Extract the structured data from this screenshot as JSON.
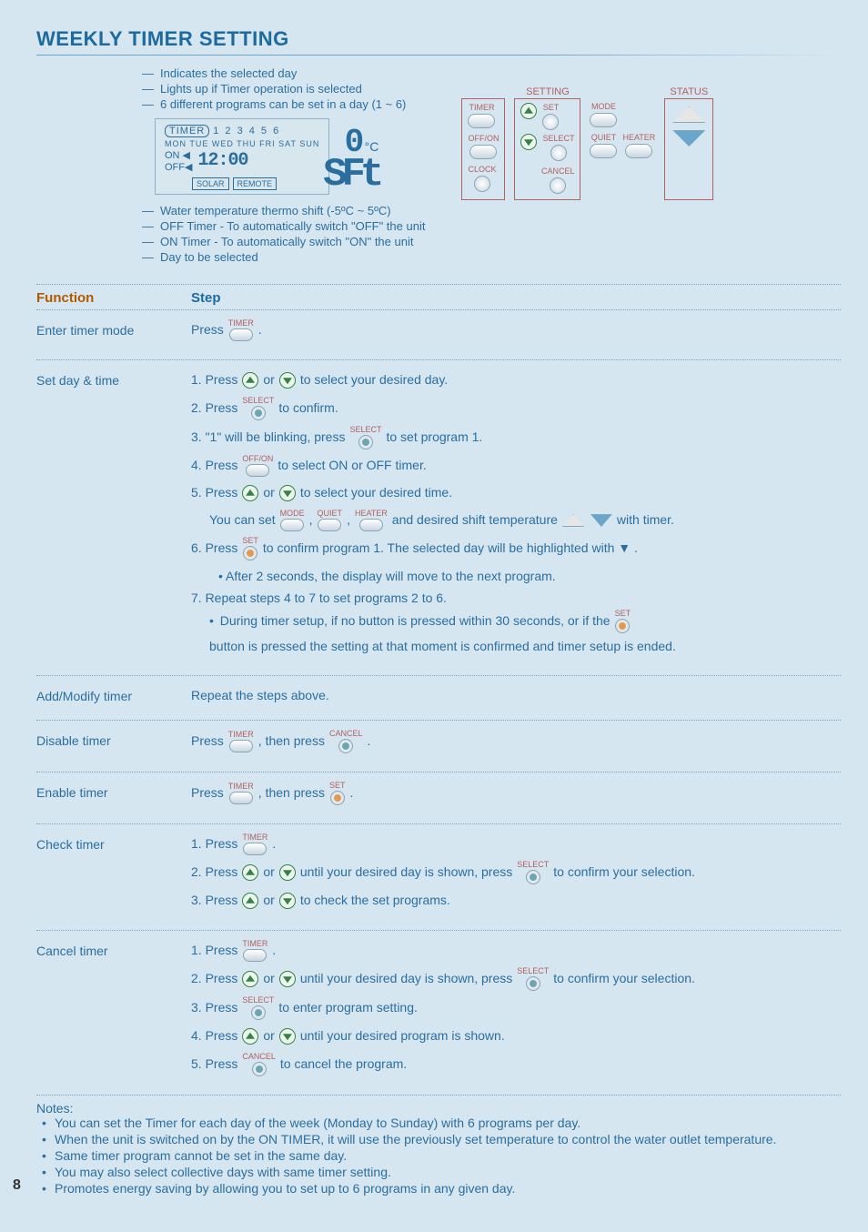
{
  "heading": "WEEKLY TIMER SETTING",
  "page_number": "8",
  "diagram": {
    "top_callouts": [
      "Indicates the selected day",
      "Lights up if Timer operation is selected",
      "6 different programs can be set in a day (1 ~ 6)"
    ],
    "lcd": {
      "timer_label": "TIMER",
      "programs": "1 2 3 4 5 6",
      "days": "MON TUE WED THU FRI SAT SUN",
      "on": "ON ◀",
      "off": "OFF◀",
      "time": "12:00",
      "solar": "SOLAR",
      "remote": "REMOTE",
      "temp_num": "0",
      "temp_c": "°C",
      "sft": "SFt"
    },
    "bottom_callouts": [
      "Water temperature thermo shift (-5ºC ~ 5ºC)",
      "OFF Timer - To automatically switch \"OFF\" the unit",
      "ON Timer - To automatically switch \"ON\" the unit",
      "Day to be selected"
    ]
  },
  "panel": {
    "groups": {
      "timer": {
        "title": "",
        "labels": {
          "timer": "TIMER",
          "offon": "OFF/ON",
          "clock": "CLOCK"
        }
      },
      "setting": {
        "title": "SETTING",
        "labels": {
          "set": "SET",
          "select": "SELECT",
          "cancel": "CANCEL"
        }
      },
      "middle": {
        "title": "",
        "labels": {
          "mode": "MODE",
          "quiet": "QUIET",
          "heater": "HEATER"
        }
      },
      "status": {
        "title": "STATUS"
      }
    }
  },
  "table": {
    "headers": {
      "function": "Function",
      "step": "Step"
    },
    "rows": {
      "enter": {
        "name": "Enter timer mode",
        "press": "Press",
        "timer": "TIMER",
        "period": "."
      },
      "setday": {
        "name": "Set day & time",
        "s1a": "1.  Press",
        "s1b": "or",
        "s1c": "to select your desired day.",
        "s2a": "2.  Press",
        "s2b_label": "SELECT",
        "s2c": "to confirm.",
        "s3a": "3.  \"1\" will be blinking, press",
        "s3b_label": "SELECT",
        "s3c": "to set program 1.",
        "s4a": "4.  Press",
        "s4b_label": "OFF/ON",
        "s4c": "to select ON or OFF timer.",
        "s5a": "5.  Press",
        "s5b": "or",
        "s5c": "to select your desired time.",
        "s5d": "You can set",
        "mode": "MODE",
        "quiet": "QUIET",
        "heater": "HEATER",
        "s5e": ",",
        "s5f": ",",
        "s5g": "and desired shift temperature",
        "s5h": "with timer.",
        "s6a": "6.  Press",
        "s6b_label": "SET",
        "s6c": "to confirm program 1. The selected day will be highlighted with ▼ .",
        "s6d": "After 2 seconds, the display will move to the next program.",
        "s7a": "7.  Repeat steps 4 to 7 to set programs 2 to 6.",
        "s7b_a": "During timer setup, if no button is pressed within 30 seconds, or if the",
        "s7b_label": "SET",
        "s7b_b": "button is pressed the setting at that moment is confirmed and timer setup is ended."
      },
      "addmodify": {
        "name": "Add/Modify timer",
        "text": "Repeat the steps above."
      },
      "disable": {
        "name": "Disable timer",
        "a": "Press",
        "timer": "TIMER",
        "b": ", then press",
        "cancel": "CANCEL",
        "c": "."
      },
      "enable": {
        "name": "Enable timer",
        "a": "Press",
        "timer": "TIMER",
        "b": ", then press",
        "set": "SET",
        "c": "."
      },
      "check": {
        "name": "Check timer",
        "s1a": "1.  Press",
        "timer": "TIMER",
        "s1b": ".",
        "s2a": "2.  Press",
        "s2b": "or",
        "s2c": "until your desired day is shown, press",
        "select": "SELECT",
        "s2d": "to confirm your selection.",
        "s3a": "3.  Press",
        "s3b": "or",
        "s3c": "to check the set programs."
      },
      "cancel": {
        "name": "Cancel timer",
        "s1a": "1.  Press",
        "timer": "TIMER",
        "s1b": ".",
        "s2a": "2.  Press",
        "s2b": "or",
        "s2c": "until your desired day is shown, press",
        "select": "SELECT",
        "s2d": "to confirm your selection.",
        "s3a": "3.  Press",
        "select2": "SELECT",
        "s3b": "to enter program setting.",
        "s4a": "4.  Press",
        "s4b": "or",
        "s4c": "until your desired program is shown.",
        "s5a": "5.  Press",
        "cancel": "CANCEL",
        "s5b": "to cancel the program."
      }
    }
  },
  "notes": {
    "title": "Notes:",
    "items": [
      "You can set the Timer for each day of the week (Monday to Sunday) with 6 programs per day.",
      "When the unit is switched on by the ON TIMER, it will use the previously set temperature to control the water outlet temperature.",
      "Same timer program cannot be set in the same day.",
      "You may also select collective days with same timer setting.",
      "Promotes energy saving by allowing you to set up to 6 programs in any given day."
    ]
  }
}
